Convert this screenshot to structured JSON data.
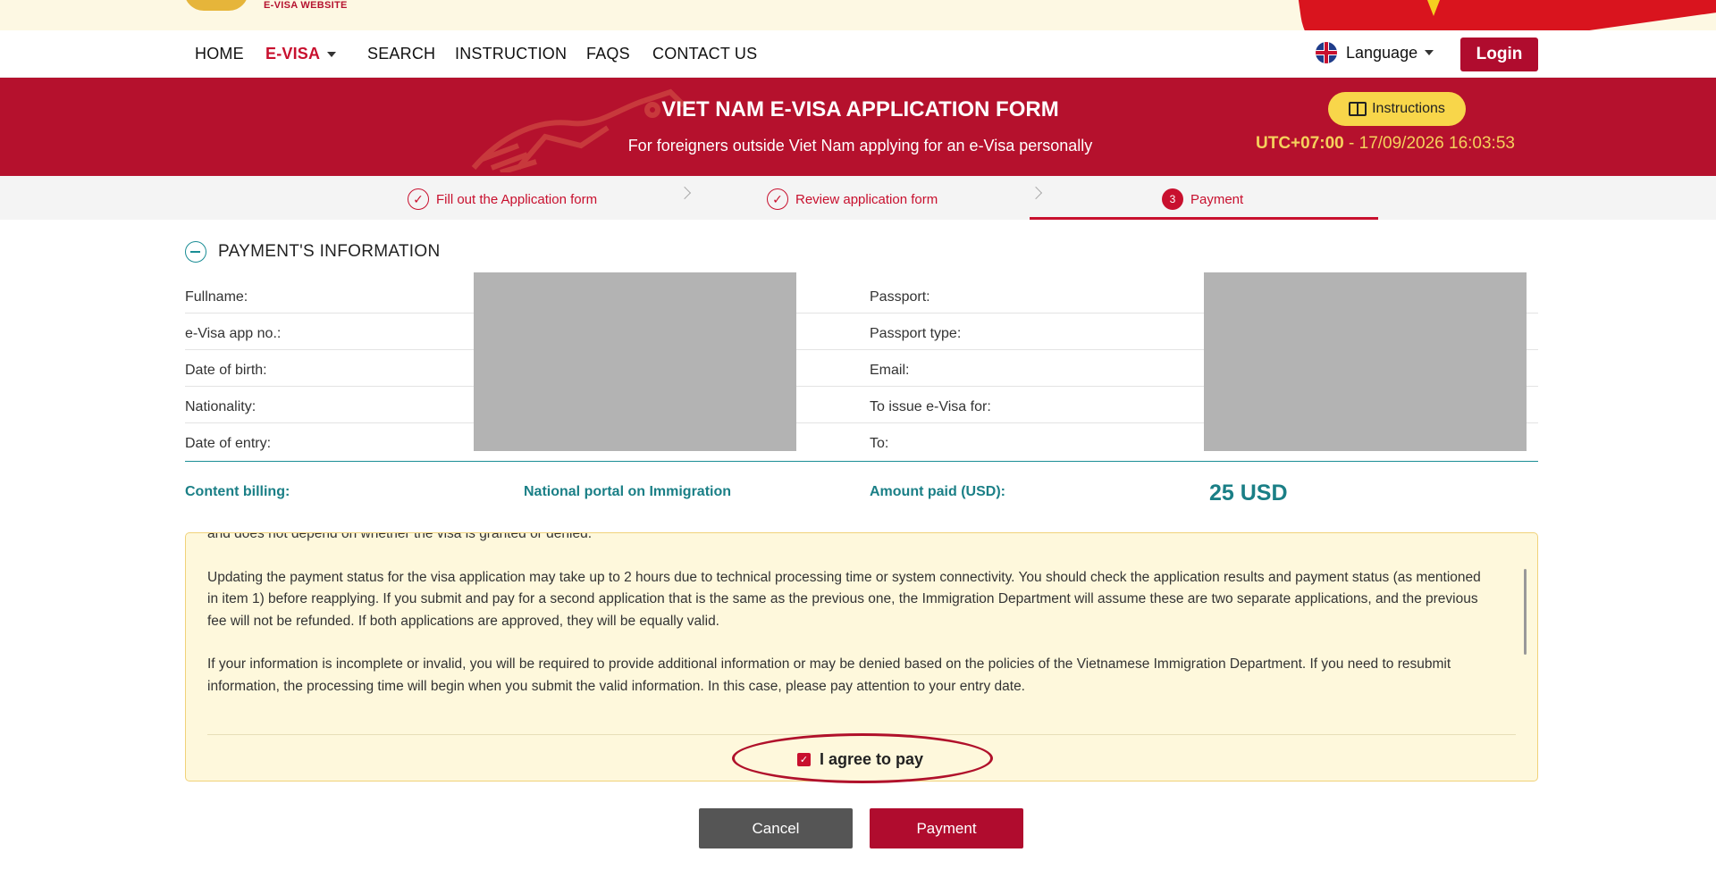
{
  "brand": {
    "subtitle": "E-VISA WEBSITE"
  },
  "nav": {
    "items": [
      {
        "label": "HOME"
      },
      {
        "label": "E-VISA"
      },
      {
        "label": "SEARCH"
      },
      {
        "label": "INSTRUCTION"
      },
      {
        "label": "FAQS"
      },
      {
        "label": "CONTACT US"
      }
    ],
    "language_label": "Language",
    "login_label": "Login"
  },
  "banner": {
    "title": "VIET NAM E-VISA APPLICATION FORM",
    "subtitle": "For foreigners outside Viet Nam applying for an e-Visa personally",
    "instructions_label": "Instructions",
    "timezone": "UTC+07:00",
    "datetime": " - 17/09/2026 16:03:53"
  },
  "steps": [
    {
      "label": "Fill out the Application form",
      "state": "done"
    },
    {
      "label": "Review application form",
      "state": "done"
    },
    {
      "label": "Payment",
      "number": "3",
      "state": "active"
    }
  ],
  "payment_info": {
    "title": "PAYMENT'S INFORMATION",
    "left_labels": [
      "Fullname:",
      "e-Visa app no.:",
      "Date of birth:",
      "Nationality:",
      "Date of entry:"
    ],
    "right_labels": [
      "Passport:",
      "Passport type:",
      "Email:",
      "To issue e-Visa for:",
      "To:"
    ],
    "content_billing_label": "Content billing:",
    "content_billing_value": "National portal on Immigration",
    "amount_label": "Amount paid (USD):",
    "amount_value": "25 USD"
  },
  "terms": {
    "paragraphs": [
      "and does not depend on whether the visa is granted or denied.",
      "Updating the payment status for the visa application may take up to 2 hours due to technical processing time or system connectivity. You should check the application results and payment status (as mentioned in item 1) before reapplying. If you submit and pay for a second application that is the same as the previous one, the Immigration Department will assume these are two separate applications, and the previous fee will not be refunded. If both applications are approved, they will be equally valid.",
      "If your information is incomplete or invalid, you will be required to provide additional information or may be denied based on the policies of the Vietnamese Immigration Department. If you need to resubmit information, the processing time will begin when you submit the valid information. In this case, please pay attention to your entry date."
    ],
    "agree_label": "I agree to pay",
    "agree_checked": true
  },
  "actions": {
    "cancel_label": "Cancel",
    "payment_label": "Payment"
  },
  "colors": {
    "brand_red": "#b5112d",
    "teal": "#1a7f86",
    "highlight_yellow": "#f8d64a"
  }
}
